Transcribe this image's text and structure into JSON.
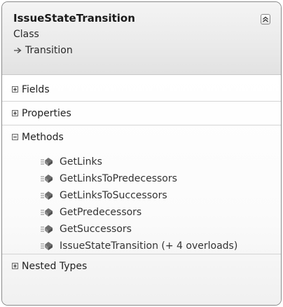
{
  "class_shape": {
    "name": "IssueStateTransition",
    "kind": "Class",
    "base_type": "Transition",
    "collapse_icon": "double-chevron-up-icon",
    "inherit_icon": "arrow-right-icon"
  },
  "compartments": {
    "fields": {
      "label": "Fields",
      "state": "collapsed"
    },
    "properties": {
      "label": "Properties",
      "state": "collapsed"
    },
    "methods": {
      "label": "Methods",
      "state": "expanded",
      "items": [
        {
          "label": "GetLinks",
          "icon": "method-icon"
        },
        {
          "label": "GetLinksToPredecessors",
          "icon": "method-icon"
        },
        {
          "label": "GetLinksToSuccessors",
          "icon": "method-icon"
        },
        {
          "label": "GetPredecessors",
          "icon": "method-icon"
        },
        {
          "label": "GetSuccessors",
          "icon": "method-icon"
        },
        {
          "label": "IssueStateTransition (+ 4 overloads)",
          "icon": "method-icon"
        }
      ]
    },
    "nested_types": {
      "label": "Nested Types",
      "state": "collapsed"
    }
  }
}
